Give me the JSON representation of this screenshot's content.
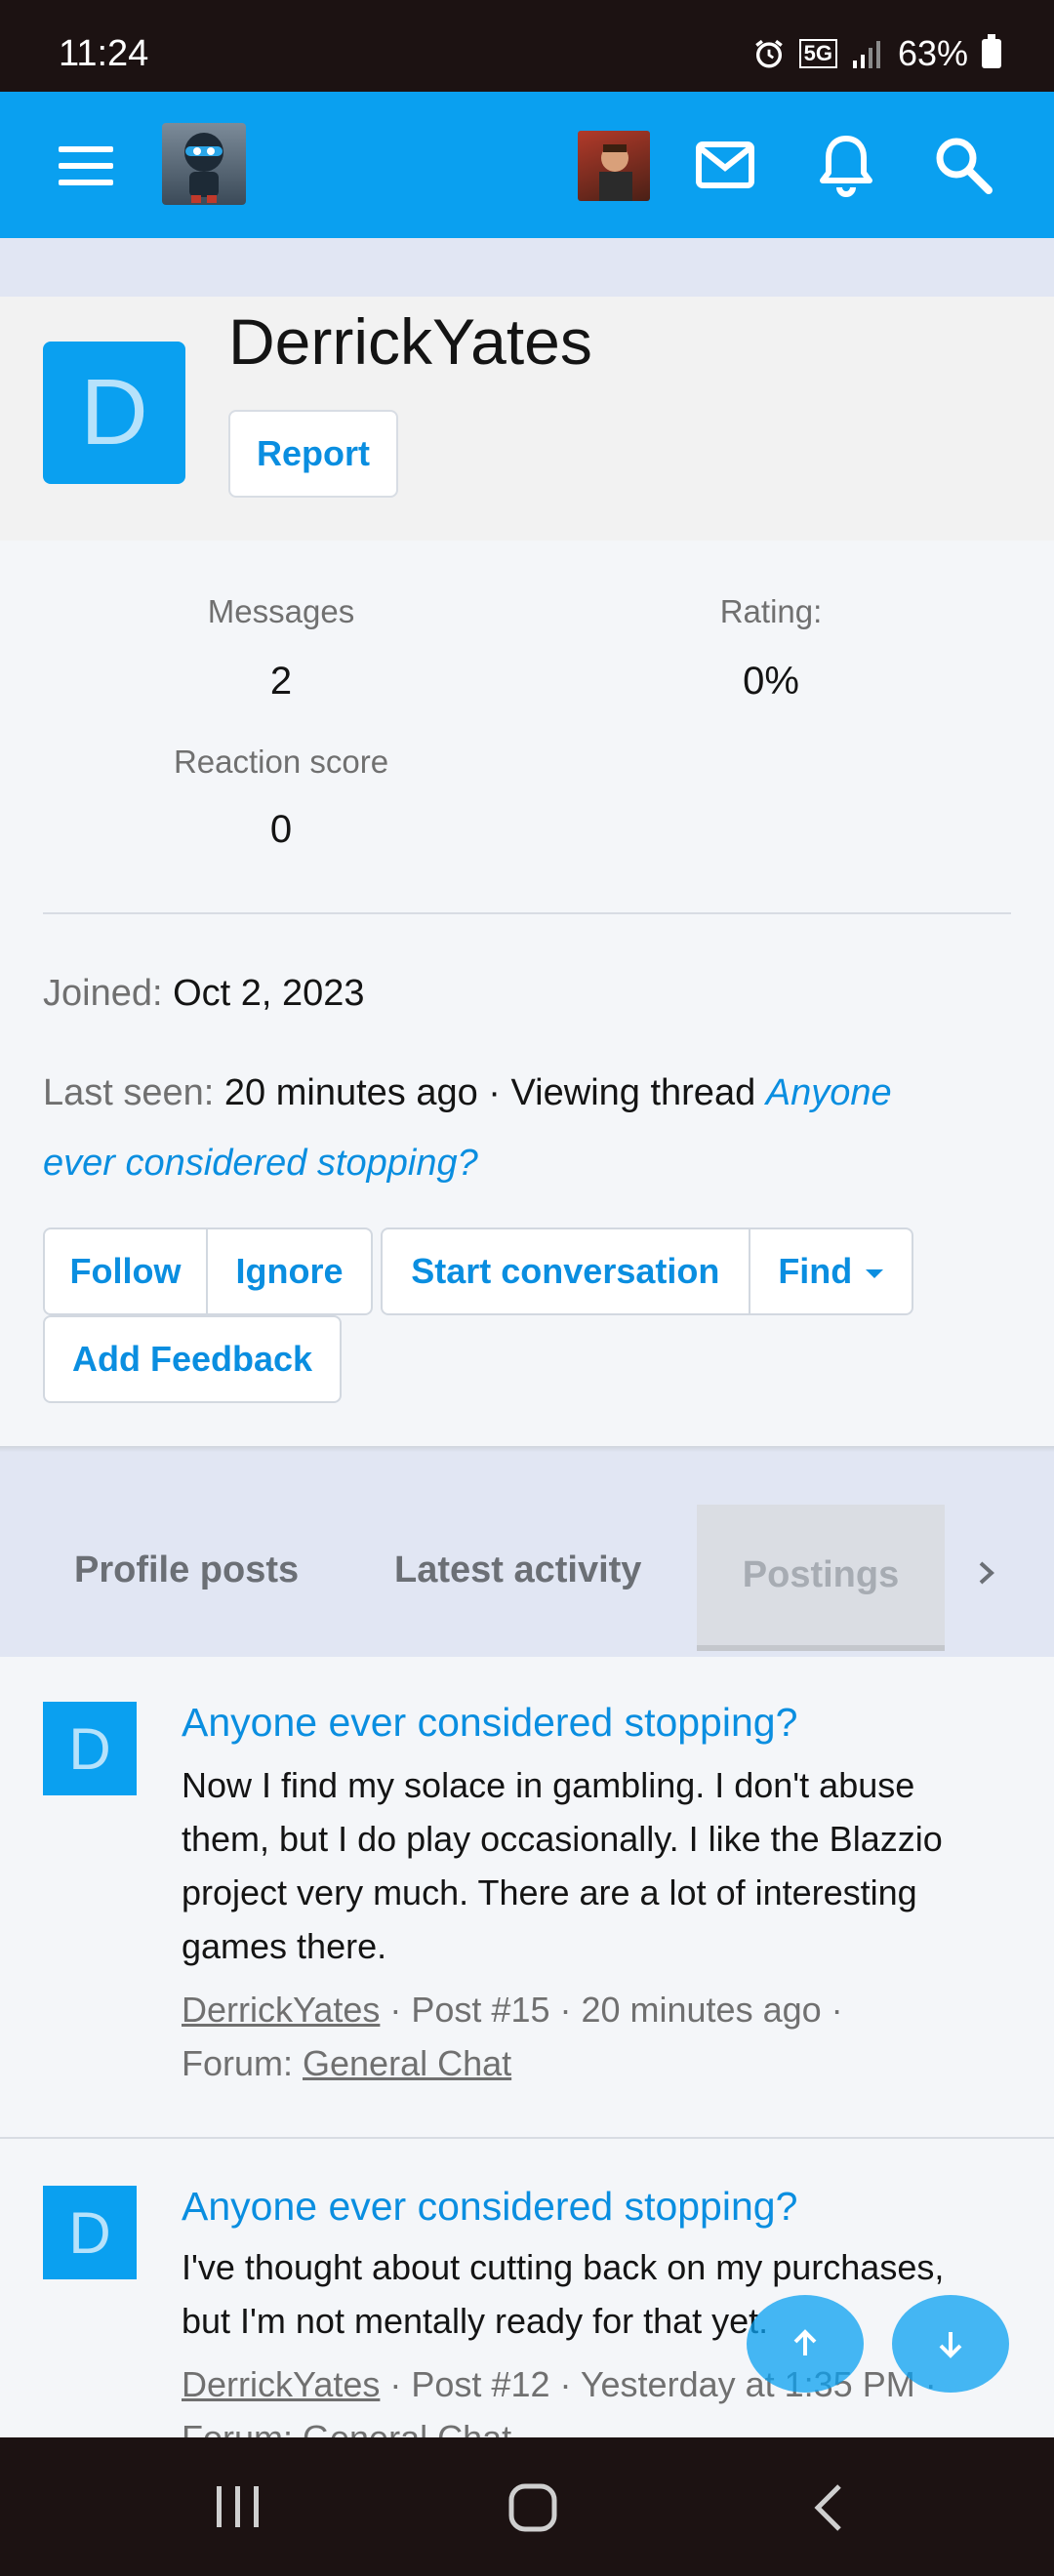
{
  "status_bar": {
    "time": "11:24",
    "battery": "63%",
    "network": "5G"
  },
  "nav": {
    "menu": "menu-icon",
    "icons": [
      "envelope-icon",
      "bell-icon",
      "search-icon"
    ]
  },
  "colors": {
    "accent": "#0aa0f0",
    "link": "#0a8ee0",
    "header_bg": "#f2f2f2",
    "tabs_bg": "#e1e6f3"
  },
  "profile": {
    "avatar_letter": "D",
    "username": "DerrickYates",
    "report_label": "Report",
    "stats": {
      "messages_label": "Messages",
      "messages_value": "2",
      "rating_label": "Rating:",
      "rating_value": "0%",
      "reaction_label": "Reaction score",
      "reaction_value": "0"
    },
    "joined_label": "Joined:",
    "joined_value": "Oct 2, 2023",
    "last_seen_label": "Last seen:",
    "last_seen_value": "20 minutes ago · Viewing thread",
    "last_seen_thread_line1": "Anyone",
    "last_seen_thread_line2": "ever considered stopping?"
  },
  "actions": {
    "follow": "Follow",
    "ignore": "Ignore",
    "start_conversation": "Start conversation",
    "find": "Find",
    "add_feedback": "Add Feedback"
  },
  "tabs": [
    "Profile posts",
    "Latest activity",
    "Postings"
  ],
  "posts": [
    {
      "avatar_letter": "D",
      "title": "Anyone ever considered stopping?",
      "body_lines": [
        "Now I find my solace in gambling. I don't abuse",
        "them, but I do play occasionally. I like the Blazzio",
        "project very much. There are a lot of interesting",
        "games there."
      ],
      "author": "DerrickYates",
      "meta": " · Post #15 · 20 minutes ago ·",
      "forum_label": "Forum: ",
      "forum": "General Chat"
    },
    {
      "avatar_letter": "D",
      "title": "Anyone ever considered stopping?",
      "body_lines": [
        "I've thought about cutting back on my purchases,",
        "but I'm not mentally ready for that yet."
      ],
      "author": "DerrickYates",
      "meta": " · Post #12 · Yesterday at 1:35 PM ·",
      "forum_label": "Forum: ",
      "forum": "General Chat"
    }
  ]
}
